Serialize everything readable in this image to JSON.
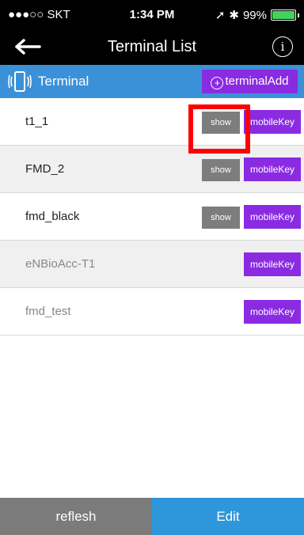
{
  "status": {
    "carrier": "●●●○○ SKT",
    "time": "1:34 PM",
    "battery": "99%"
  },
  "nav": {
    "title": "Terminal List",
    "back_icon": "back-arrow-icon",
    "info_icon": "info-icon"
  },
  "section": {
    "label": "Terminal",
    "add_label": "terminalAdd"
  },
  "rows": [
    {
      "name": "t1_1",
      "show": "show",
      "key": "mobileKey"
    },
    {
      "name": "FMD_2",
      "show": "show",
      "key": "mobileKey"
    },
    {
      "name": "fmd_black",
      "show": "show",
      "key": "mobileKey"
    },
    {
      "name": "eNBioAcc-T1",
      "key": "mobileKey"
    },
    {
      "name": "fmd_test",
      "key": "mobileKey"
    }
  ],
  "bottom": {
    "reflesh": "reflesh",
    "edit": "Edit"
  },
  "colors": {
    "accent_blue": "#3a91d8",
    "purple": "#8a2be2",
    "gray_button": "#7d7d7d",
    "highlight": "#ff0000"
  }
}
